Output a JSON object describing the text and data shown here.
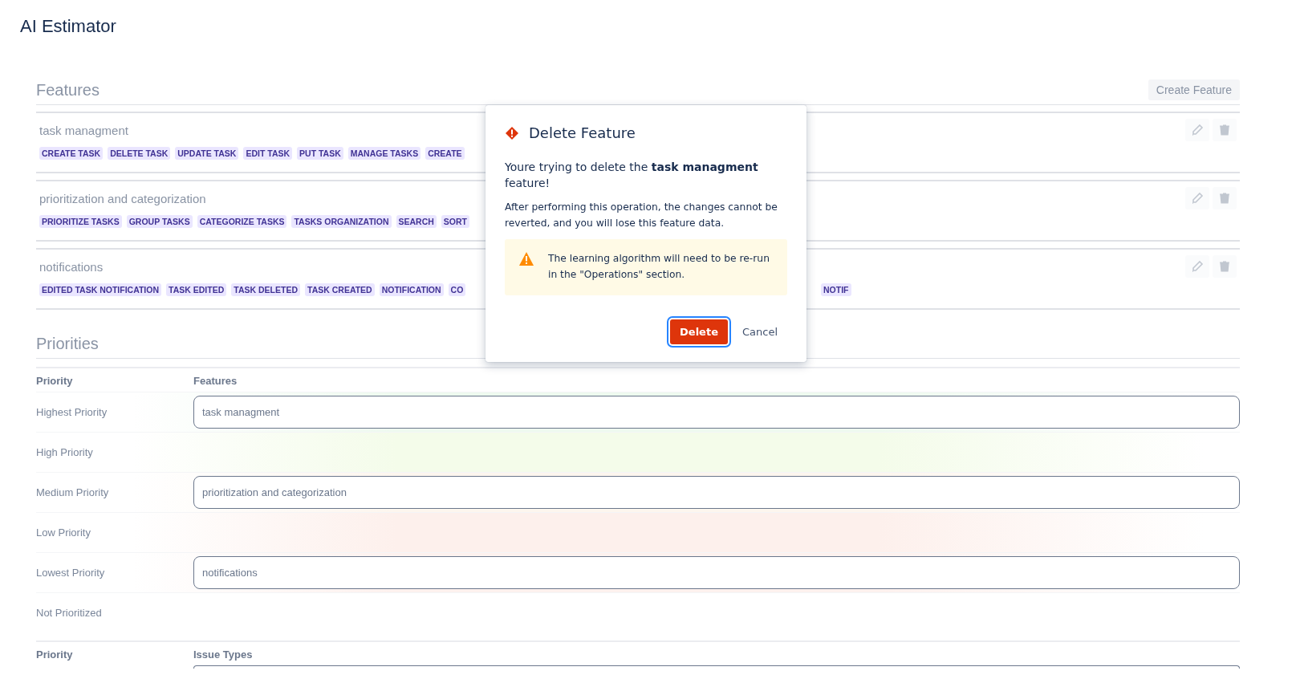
{
  "app": {
    "title": "AI Estimator"
  },
  "features_section": {
    "heading": "Features",
    "create_button": "Create Feature",
    "features": [
      {
        "name": "task managment",
        "tags": [
          "CREATE TASK",
          "DELETE TASK",
          "UPDATE TASK",
          "EDIT TASK",
          "PUT TASK",
          "MANAGE TASKS",
          "CREATE"
        ]
      },
      {
        "name": "prioritization and categorization",
        "tags": [
          "PRIORITIZE TASKS",
          "GROUP TASKS",
          "CATEGORIZE TASKS",
          "TASKS ORGANIZATION",
          "SEARCH",
          "SORT"
        ]
      },
      {
        "name": "notifications",
        "tags": [
          "EDITED TASK NOTIFICATION",
          "TASK EDITED",
          "TASK DELETED",
          "TASK CREATED",
          "NOTIFICATION",
          "CO"
        ],
        "tags_after_dialog": [
          "NOTIF"
        ]
      }
    ]
  },
  "priorities_section": {
    "heading": "Priorities",
    "columns": [
      "Priority",
      "Features"
    ],
    "rows": [
      {
        "priority": "Highest Priority",
        "color": "#eefaef",
        "value": "task managment"
      },
      {
        "priority": "High Priority",
        "color": "#f4fcea"
      },
      {
        "priority": "Medium Priority",
        "color": "#fdf6ee",
        "value": "prioritization and categorization"
      },
      {
        "priority": "Low Priority",
        "color": "#fdf0ec"
      },
      {
        "priority": "Lowest Priority",
        "color": "#fdf1ee",
        "value": "notifications"
      },
      {
        "priority": "Not Prioritized"
      }
    ],
    "second_columns": [
      "Priority",
      "Issue Types"
    ]
  },
  "dialog": {
    "title": "Delete Feature",
    "message": "Youre trying to delete the **task managment** feature!",
    "details": "After performing this operation, the changes cannot be reverted, and you will lose this feature data.",
    "warning": "The learning algorithm will need to be re-run in the \"Operations\" section.",
    "buttons": [
      {
        "label": "Delete",
        "kind": "danger",
        "focused": true
      },
      {
        "label": "Cancel",
        "kind": "subtle",
        "focused": false
      }
    ]
  }
}
